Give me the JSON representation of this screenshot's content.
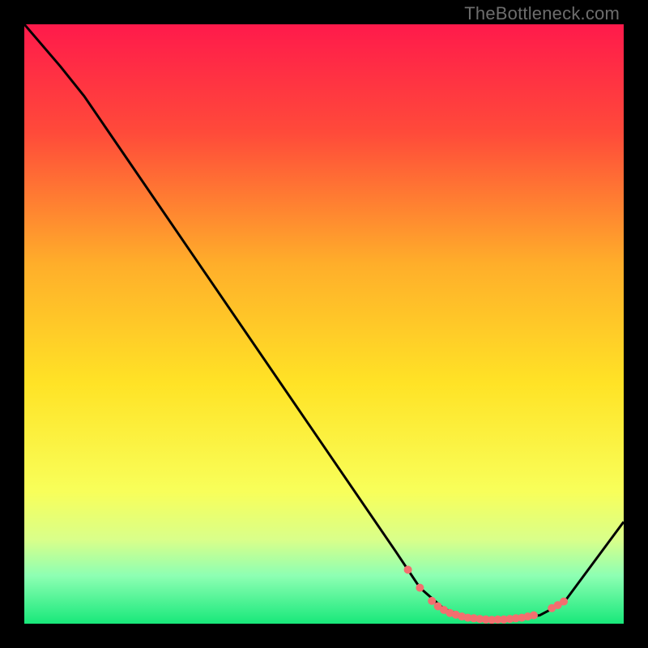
{
  "watermark": "TheBottleneck.com",
  "chart_data": {
    "type": "line",
    "title": "",
    "xlabel": "",
    "ylabel": "",
    "xlim": [
      0,
      100
    ],
    "ylim": [
      0,
      100
    ],
    "gradient_stops": [
      {
        "offset": 0,
        "color": "#ff1a4b"
      },
      {
        "offset": 18,
        "color": "#ff4a3a"
      },
      {
        "offset": 40,
        "color": "#ffae2a"
      },
      {
        "offset": 60,
        "color": "#ffe326"
      },
      {
        "offset": 78,
        "color": "#f8ff5a"
      },
      {
        "offset": 86,
        "color": "#d9ff8a"
      },
      {
        "offset": 92,
        "color": "#8dffb3"
      },
      {
        "offset": 100,
        "color": "#18e87a"
      }
    ],
    "curve": [
      {
        "x": 0,
        "y": 100
      },
      {
        "x": 6,
        "y": 93
      },
      {
        "x": 10,
        "y": 88
      },
      {
        "x": 62,
        "y": 12
      },
      {
        "x": 66,
        "y": 6
      },
      {
        "x": 70,
        "y": 2.5
      },
      {
        "x": 74,
        "y": 1.0
      },
      {
        "x": 80,
        "y": 0.7
      },
      {
        "x": 86,
        "y": 1.4
      },
      {
        "x": 90,
        "y": 3.5
      },
      {
        "x": 100,
        "y": 17
      }
    ],
    "markers": [
      {
        "x": 64,
        "y": 9.0
      },
      {
        "x": 66,
        "y": 6.0
      },
      {
        "x": 68,
        "y": 3.8
      },
      {
        "x": 69,
        "y": 2.9
      },
      {
        "x": 70,
        "y": 2.3
      },
      {
        "x": 71,
        "y": 1.8
      },
      {
        "x": 72,
        "y": 1.5
      },
      {
        "x": 73,
        "y": 1.2
      },
      {
        "x": 74,
        "y": 1.0
      },
      {
        "x": 75,
        "y": 0.9
      },
      {
        "x": 76,
        "y": 0.8
      },
      {
        "x": 77,
        "y": 0.7
      },
      {
        "x": 78,
        "y": 0.65
      },
      {
        "x": 79,
        "y": 0.7
      },
      {
        "x": 80,
        "y": 0.7
      },
      {
        "x": 81,
        "y": 0.8
      },
      {
        "x": 82,
        "y": 0.9
      },
      {
        "x": 83,
        "y": 1.0
      },
      {
        "x": 84,
        "y": 1.2
      },
      {
        "x": 85,
        "y": 1.4
      },
      {
        "x": 88,
        "y": 2.6
      },
      {
        "x": 89,
        "y": 3.1
      },
      {
        "x": 90,
        "y": 3.7
      }
    ],
    "marker_color": "#f36f6f",
    "marker_radius": 5
  }
}
